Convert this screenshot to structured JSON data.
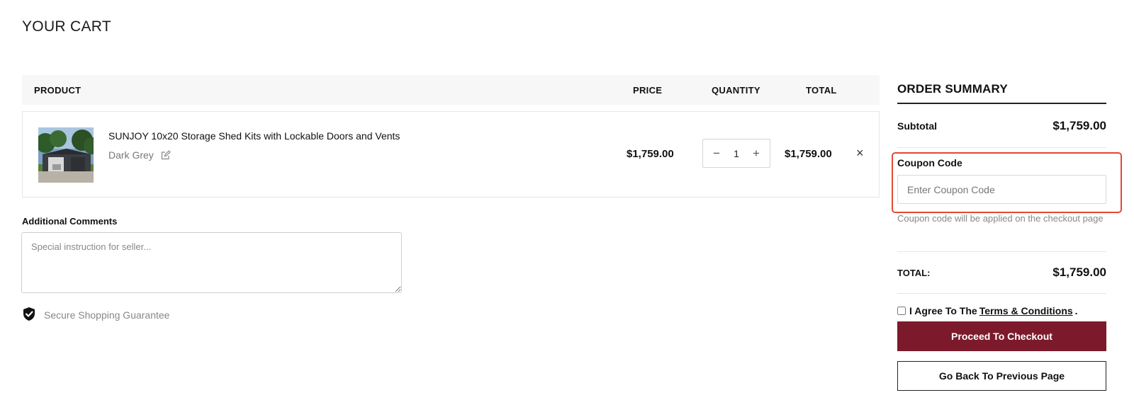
{
  "page": {
    "title": "YOUR CART"
  },
  "cart": {
    "columns": {
      "product": "PRODUCT",
      "price": "PRICE",
      "quantity": "QUANTITY",
      "total": "TOTAL"
    },
    "items": [
      {
        "name": "SUNJOY 10x20 Storage Shed Kits with Lockable Doors and Vents",
        "variant": "Dark Grey",
        "price": "$1,759.00",
        "quantity": "1",
        "total": "$1,759.00",
        "decrease_symbol": "−",
        "increase_symbol": "+",
        "remove_symbol": "×"
      }
    ]
  },
  "comments": {
    "label": "Additional Comments",
    "placeholder": "Special instruction for seller..."
  },
  "secure": {
    "text": "Secure Shopping Guarantee",
    "icon": "shield-check-icon"
  },
  "summary": {
    "title": "ORDER SUMMARY",
    "subtotal_label": "Subtotal",
    "subtotal_value": "$1,759.00",
    "coupon_label": "Coupon Code",
    "coupon_placeholder": "Enter Coupon Code",
    "coupon_note": "Coupon code will be applied on the checkout page",
    "total_label": "TOTAL:",
    "total_value": "$1,759.00",
    "agree_prefix": "I Agree To The",
    "agree_link": "Terms & Conditions",
    "agree_suffix": ".",
    "checkout_label": "Proceed To Checkout",
    "back_label": "Go Back To Previous Page"
  },
  "colors": {
    "checkout_button": "#7c1a2c",
    "highlight_border": "#e24a33",
    "header_bg": "#f7f7f7"
  }
}
